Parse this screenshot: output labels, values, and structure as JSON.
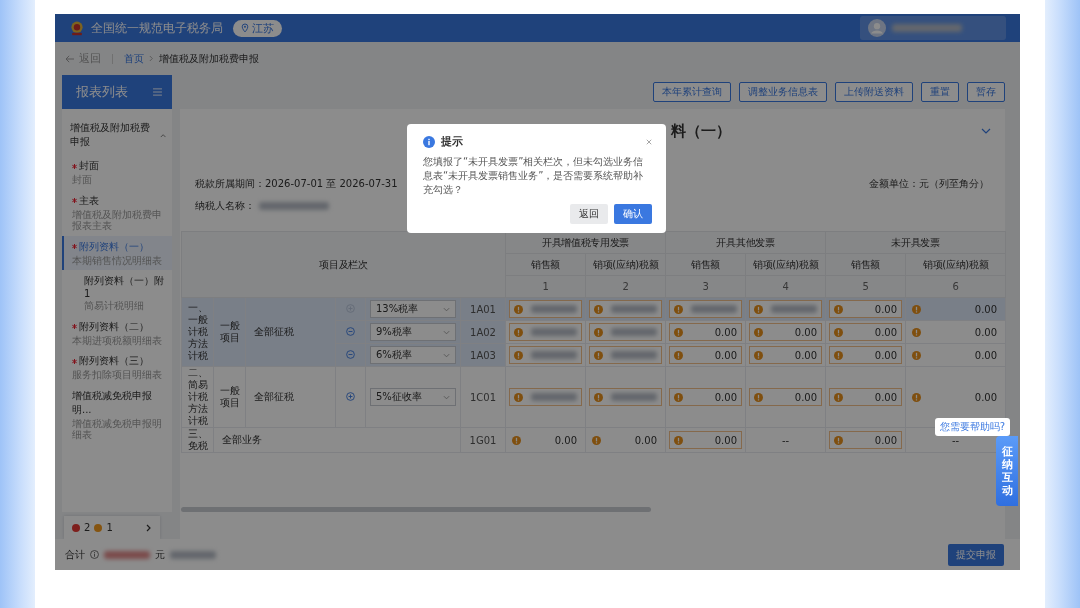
{
  "header": {
    "title": "全国统一规范电子税务局",
    "region": "江苏"
  },
  "breadcrumb": {
    "back": "返回",
    "items": [
      "首页",
      "增值税及附加税费申报"
    ]
  },
  "sidebar": {
    "title": "报表列表",
    "group": {
      "label": "增值税及附加税费申报",
      "expanded": true
    },
    "items": [
      {
        "title": "封面",
        "subtitle": "封面",
        "required": true,
        "selected": false
      },
      {
        "title": "主表",
        "subtitle": "增值税及附加税费申报表主表",
        "required": true,
        "selected": false
      },
      {
        "title": "附列资料（一）",
        "subtitle": "本期销售情况明细表",
        "required": true,
        "selected": true,
        "children": [
          {
            "title": "附列资料（一）附1",
            "subtitle": "简易计税明细",
            "required": false,
            "selected": false
          }
        ]
      },
      {
        "title": "附列资料（二）",
        "subtitle": "本期进项税额明细表",
        "required": true,
        "selected": false
      },
      {
        "title": "附列资料（三）",
        "subtitle": "服务扣除项目明细表",
        "required": true,
        "selected": false
      },
      {
        "title": "增值税减免税申报明...",
        "subtitle": "增值税减免税申报明细表",
        "required": false,
        "selected": false
      }
    ]
  },
  "issues": {
    "errors": "2",
    "warnings": "1"
  },
  "toolbar": [
    "本年累计查询",
    "调整业务信息表",
    "上传附送资料",
    "重置",
    "暂存"
  ],
  "form": {
    "title": "料（一）",
    "period": "税款所属期间：2026-07-01 至 2026-07-31",
    "unit": "金额单位：元（列至角分）",
    "taxpayer_label": "纳税人名称："
  },
  "table": {
    "item_header": "项目及栏次",
    "groups": [
      {
        "label": "开具增值税专用发票",
        "columns": [
          "销售额",
          "销项(应纳)税额"
        ]
      },
      {
        "label": "开具其他发票",
        "columns": [
          "销售额",
          "销项(应纳)税额"
        ]
      },
      {
        "label": "未开具发票",
        "columns": [
          "销售额",
          "销项(应纳)税额"
        ]
      }
    ],
    "column_numbers": [
      "1",
      "2",
      "3",
      "4",
      "5",
      "6"
    ],
    "sections": [
      {
        "label": "一、一般计税方法计税",
        "category": "一般项目",
        "item": "全部征税",
        "highlighted": true,
        "rows": [
          {
            "action": {
              "kind": "add",
              "disabled": true
            },
            "rate": "13%税率",
            "code": "1A01",
            "selected": true,
            "cells": [
              {
                "kind": "input"
              },
              {
                "kind": "input"
              },
              {
                "kind": "input"
              },
              {
                "kind": "input"
              },
              {
                "kind": "input",
                "value": "0.00"
              },
              {
                "kind": "readonly",
                "value": "0.00"
              }
            ]
          },
          {
            "action": {
              "kind": "remove",
              "disabled": false
            },
            "rate": "9%税率",
            "code": "1A02",
            "selected": false,
            "cells": [
              {
                "kind": "input"
              },
              {
                "kind": "input"
              },
              {
                "kind": "input",
                "value": "0.00"
              },
              {
                "kind": "input",
                "value": "0.00"
              },
              {
                "kind": "input",
                "value": "0.00"
              },
              {
                "kind": "readonly",
                "value": "0.00"
              }
            ]
          },
          {
            "action": {
              "kind": "remove",
              "disabled": false
            },
            "rate": "6%税率",
            "code": "1A03",
            "selected": false,
            "cells": [
              {
                "kind": "input"
              },
              {
                "kind": "input"
              },
              {
                "kind": "input",
                "value": "0.00"
              },
              {
                "kind": "input",
                "value": "0.00"
              },
              {
                "kind": "input",
                "value": "0.00"
              },
              {
                "kind": "readonly",
                "value": "0.00"
              }
            ]
          }
        ]
      },
      {
        "label": "二、简易计税方法计税",
        "category": "一般项目",
        "item": "全部征税",
        "highlighted": false,
        "rows": [
          {
            "action": {
              "kind": "add",
              "disabled": false
            },
            "rate": "5%征收率",
            "code": "1C01",
            "selected": false,
            "cells": [
              {
                "kind": "input"
              },
              {
                "kind": "input"
              },
              {
                "kind": "input",
                "value": "0.00"
              },
              {
                "kind": "input",
                "value": "0.00"
              },
              {
                "kind": "input",
                "value": "0.00"
              },
              {
                "kind": "readonly",
                "value": "0.00"
              }
            ]
          }
        ]
      },
      {
        "label": "三、免税",
        "item": "全部业务",
        "highlighted": false,
        "rows": [
          {
            "code": "1G01",
            "selected": false,
            "cells": [
              {
                "kind": "readonly",
                "value": "0.00"
              },
              {
                "kind": "readonly",
                "value": "0.00"
              },
              {
                "kind": "input",
                "value": "0.00"
              },
              {
                "kind": "dash",
                "value": "--"
              },
              {
                "kind": "input",
                "value": "0.00"
              },
              {
                "kind": "dash",
                "value": "--"
              }
            ]
          }
        ]
      }
    ]
  },
  "footer": {
    "total_label": "合计",
    "currency": "元",
    "submit": "提交申报"
  },
  "help": {
    "bubble": "您需要帮助吗?",
    "button": "征纳互动"
  },
  "dialog": {
    "title": "提示",
    "message": "您填报了“未开具发票”相关栏次，但未勾选业务信息表“未开具发票销售业务”，是否需要系统帮助补充勾选？",
    "buttons": [
      {
        "label": "返回",
        "primary": false
      },
      {
        "label": "确认",
        "primary": true
      }
    ]
  }
}
